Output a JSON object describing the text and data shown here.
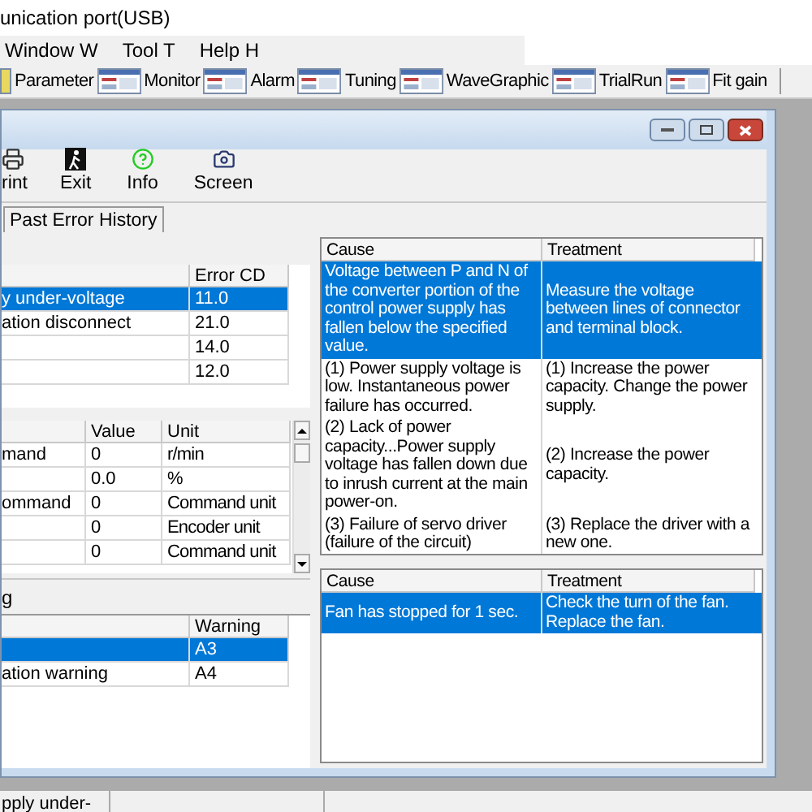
{
  "app_title": "unication port(USB)",
  "menu": [
    "Window W",
    "Tool T",
    "Help H"
  ],
  "toolbar": [
    {
      "label": "Parameter"
    },
    {
      "label": "Monitor"
    },
    {
      "label": "Alarm"
    },
    {
      "label": "Tuning"
    },
    {
      "label": "WaveGraphic"
    },
    {
      "label": "TrialRun"
    },
    {
      "label": "Fit gain"
    }
  ],
  "child_window": {
    "tools": [
      {
        "label": "rint",
        "kind": "printer"
      },
      {
        "label": "Exit",
        "kind": "exit"
      },
      {
        "label": "Info",
        "kind": "help"
      },
      {
        "label": "Screen",
        "kind": "camera"
      }
    ],
    "tabs": [
      {
        "label": "Past Error History",
        "selected": false
      }
    ],
    "error_table": {
      "code_header": "Error CD",
      "rows": [
        {
          "name": "y under-voltage",
          "code": "11.0",
          "selected": true
        },
        {
          "name": "ation disconnect",
          "code": "21.0",
          "selected": false
        },
        {
          "code": "14.0",
          "selected": false
        },
        {
          "code": "12.0",
          "selected": false
        }
      ]
    },
    "monitor_table": {
      "value_header": "Value",
      "unit_header": "Unit",
      "rows": [
        {
          "name": "mand",
          "value": "0",
          "unit": "r/min"
        },
        {
          "value": "0.0",
          "unit": "%"
        },
        {
          "name": "ommand",
          "value": "0",
          "unit": "Command unit"
        },
        {
          "value": "0",
          "unit": "Encoder unit"
        },
        {
          "value": "0",
          "unit": "Command unit"
        }
      ]
    },
    "warning_label": "g",
    "warning_table": {
      "code_header": "Warning",
      "rows": [
        {
          "code": "A3",
          "selected": true
        },
        {
          "name": "ation warning",
          "code": "A4",
          "selected": false
        }
      ]
    },
    "error_causes": {
      "cause_header": "Cause",
      "treatment_header": "Treatment",
      "rows": [
        {
          "cause": "Voltage between P and N of the converter portion of the control power supply has fallen below the specified value.",
          "treatment": "Measure the voltage between lines of connector and terminal block.",
          "selected": true
        },
        {
          "cause": "(1) Power supply voltage is low. Instantaneous power failure has occurred.",
          "treatment": "(1) Increase the power capacity. Change the power supply.",
          "selected": false
        },
        {
          "cause": "(2) Lack of power capacity...Power supply voltage has fallen down due to inrush current at the main power-on.",
          "treatment": "(2) Increase the power capacity.",
          "selected": false
        },
        {
          "cause": "(3) Failure of servo driver (failure of the circuit)",
          "treatment": "(3) Replace the driver with a new one.",
          "selected": false
        }
      ]
    },
    "warning_causes": {
      "cause_header": "Cause",
      "treatment_header": "Treatment",
      "rows": [
        {
          "cause": "Fan has stopped for 1 sec.",
          "treatment": "Check the turn of the fan. Replace the fan.",
          "selected": true
        }
      ]
    }
  },
  "status_bar": [
    "pply under-"
  ]
}
